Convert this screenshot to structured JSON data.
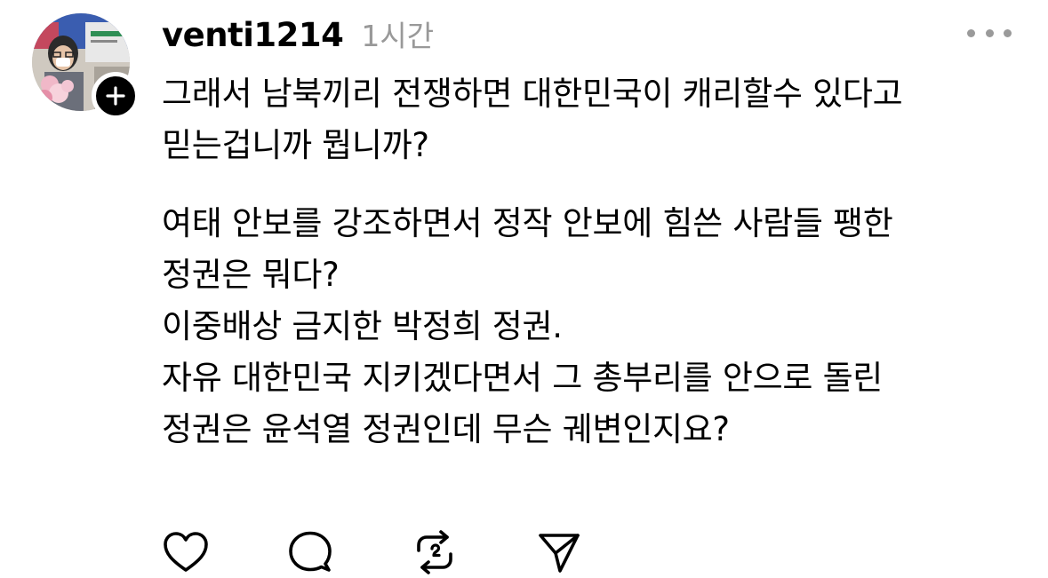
{
  "post": {
    "username": "venti1214",
    "timestamp": "1시간",
    "body_lines": [
      "그래서 남북끼리 전쟁하면 대한민국이 캐리할수 있다고",
      "믿는겁니까 뭡니까?",
      "여태 안보를 강조하면서 정작 안보에 힘쓴 사람들 팽한",
      "정권은 뭐다?",
      "이중배상 금지한 박정희 정권.",
      "자유 대한민국 지키겠다면서 그 총부리를 안으로 돌린",
      "정권은 윤석열 정권인데 무슨 궤변인지요?"
    ]
  },
  "icons": {
    "avatar": "profile-photo",
    "follow": "plus-icon",
    "more": "more-dots-icon",
    "like": "heart-icon",
    "reply": "comment-icon",
    "repost": "repost-icon",
    "share": "send-icon"
  },
  "colors": {
    "text": "#000000",
    "muted": "#999999",
    "icon": "#000000"
  }
}
